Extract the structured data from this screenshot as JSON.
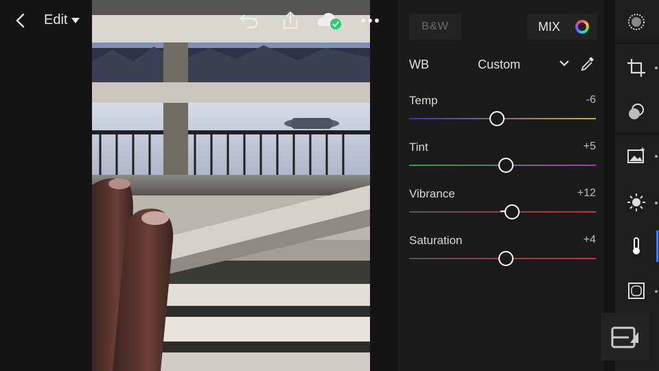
{
  "header": {
    "back_icon": "chevron-left-icon",
    "edit_label": "Edit",
    "icons": [
      "undo-icon",
      "share-icon",
      "cloud-synced-icon",
      "more-icon"
    ]
  },
  "panel": {
    "bw_label": "B&W",
    "mix_label": "MIX",
    "wb": {
      "label": "WB",
      "value": "Custom"
    },
    "sliders": [
      {
        "label": "Temp",
        "value": "-6",
        "fraction": 0.47,
        "gradient": [
          "#3d2cbc",
          "#c9b33a"
        ]
      },
      {
        "label": "Tint",
        "value": "+5",
        "fraction": 0.52,
        "gradient": [
          "#2ba43b",
          "#a83aad"
        ]
      },
      {
        "label": "Vibrance",
        "value": "+12",
        "fraction": 0.55,
        "gradient": [
          "#555555",
          "#d03030"
        ]
      },
      {
        "label": "Saturation",
        "value": "+4",
        "fraction": 0.52,
        "gradient": [
          "#555555",
          "#d03030"
        ]
      }
    ]
  },
  "rail": {
    "icons": [
      "selective-icon",
      "crop-icon",
      "healing-icon",
      "presets-icon",
      "light-icon",
      "color-icon",
      "vignette-icon"
    ],
    "active": "color-icon"
  },
  "colors": {
    "accent": "#3a7bff",
    "cloud_ok": "#2ecc71"
  }
}
